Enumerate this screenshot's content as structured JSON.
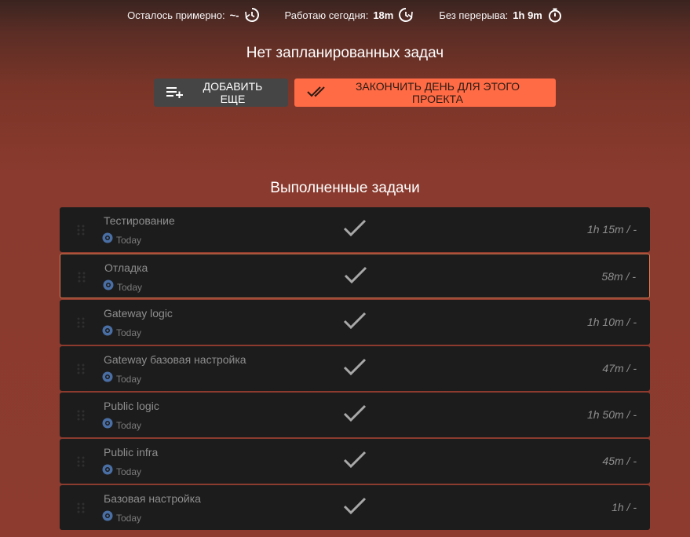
{
  "status": {
    "remaining_label": "Осталось примерно:",
    "remaining_value": "~-",
    "working_label": "Работаю сегодня:",
    "working_value": "18m",
    "nobreak_label": "Без перерыва:",
    "nobreak_value": "1h 9m"
  },
  "scheduled": {
    "empty_title": "Нет запланированных задач"
  },
  "buttons": {
    "add_more": "ДОБАВИТЬ ЕЩЕ",
    "finish_day": "ЗАКОНЧИТЬ ДЕНЬ ДЛЯ ЭТОГО ПРОЕКТА"
  },
  "completed": {
    "title": "Выполненные задачи",
    "tasks": [
      {
        "title": "Тестирование",
        "date": "Today",
        "duration": "1h 15m / -"
      },
      {
        "title": "Отладка",
        "date": "Today",
        "duration": "58m / -"
      },
      {
        "title": "Gateway logic",
        "date": "Today",
        "duration": "1h 10m / -"
      },
      {
        "title": "Gateway базовая настройка",
        "date": "Today",
        "duration": "47m / -"
      },
      {
        "title": "Public logic",
        "date": "Today",
        "duration": "1h 50m / -"
      },
      {
        "title": "Public infra",
        "date": "Today",
        "duration": "45m / -"
      },
      {
        "title": "Базовая настройка",
        "date": "Today",
        "duration": "1h / -"
      }
    ]
  },
  "colors": {
    "accent": "#ff6b45",
    "task_bg": "#1c1c1c",
    "selected_border": "#e07a50"
  },
  "icons": [
    "clock-icon",
    "stopwatch-icon",
    "add-list-icon",
    "double-check-icon",
    "drag-handle-icon",
    "project-icon",
    "check-icon"
  ]
}
